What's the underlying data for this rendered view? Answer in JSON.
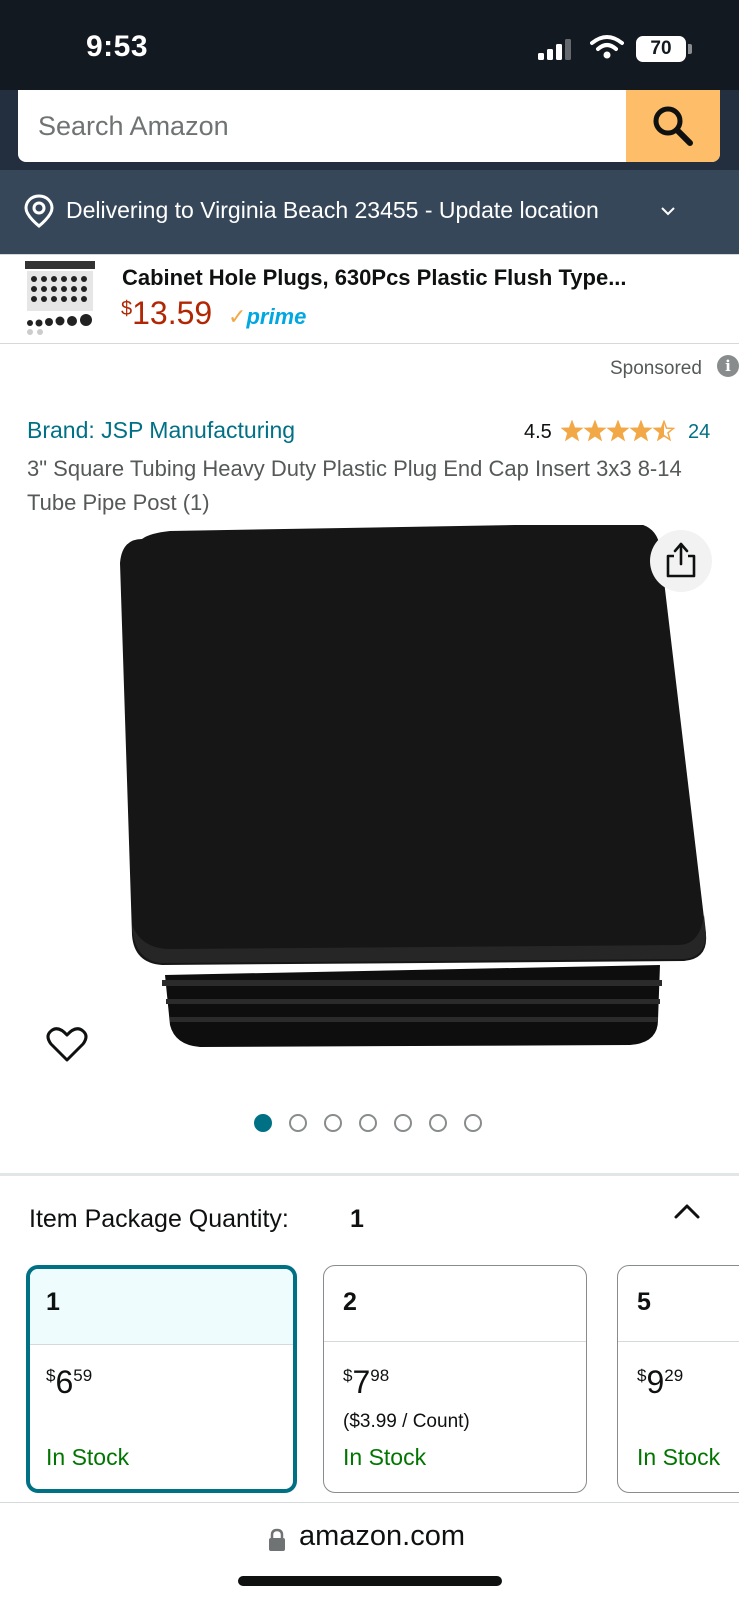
{
  "status_bar": {
    "time": "9:53",
    "battery": "70"
  },
  "search": {
    "placeholder": "Search Amazon",
    "icon": "search-icon"
  },
  "location": {
    "text": "Delivering to Virginia Beach 23455 - Update location",
    "icon": "location-pin-icon"
  },
  "ad": {
    "title": "Cabinet Hole Plugs, 630Pcs Plastic Flush Type...",
    "currency": "$",
    "price": "13.59",
    "prime_label": "prime",
    "sponsored_label": "Sponsored",
    "info_icon": "i"
  },
  "product": {
    "brand": "Brand: JSP Manufacturing",
    "rating": "4.5",
    "stars": 4.5,
    "review_count": "24",
    "title": "3\" Square Tubing Heavy Duty Plastic Plug End Cap Insert 3x3 8-14 Tube Pipe Post (1)",
    "image_count": 7,
    "active_image": 0
  },
  "quantity": {
    "label": "Item Package Quantity:",
    "selected": "1",
    "options": [
      {
        "count": "1",
        "currency": "$",
        "whole": "6",
        "fraction": "59",
        "unit_price": "",
        "stock": "In Stock"
      },
      {
        "count": "2",
        "currency": "$",
        "whole": "7",
        "fraction": "98",
        "unit_price": "($3.99 / Count)",
        "stock": "In Stock"
      },
      {
        "count": "5",
        "currency": "$",
        "whole": "9",
        "fraction": "29",
        "unit_price": "",
        "stock": "In Stock"
      }
    ]
  },
  "browser": {
    "url": "amazon.com"
  },
  "colors": {
    "nav_dark": "#131921",
    "search_bar": "#232f3e",
    "location_bar": "#37475a",
    "search_button": "#febd69",
    "link": "#007185",
    "price_red": "#b12704",
    "stock_green": "#007600",
    "star": "#f3a847"
  }
}
